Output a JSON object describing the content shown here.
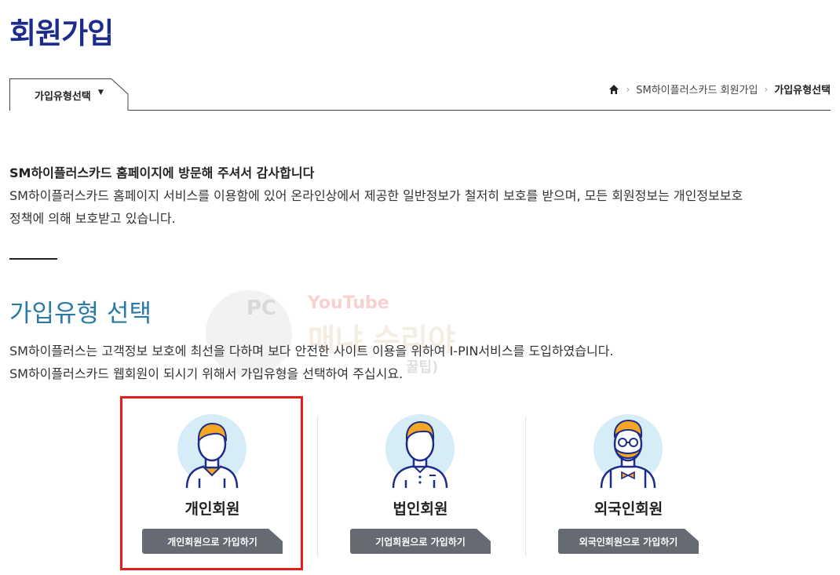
{
  "page": {
    "title": "회원가입"
  },
  "tab": {
    "label": "가입유형선택"
  },
  "breadcrumb": {
    "items": [
      "SM하이플러스카드 회원가입",
      "가입유형선택"
    ]
  },
  "intro": {
    "heading": "SM하이플러스카드 홈페이지에 방문해 주셔서 감사합니다",
    "line1": "SM하이플러스카드 홈페이지 서비스를 이용함에 있어 온라인상에서 제공한 일반정보가 철저히 보호를 받으며, 모든 회원정보는 개인정보보호",
    "line2": "정책에 의해 보호받고 있습니다."
  },
  "section": {
    "title": "가입유형 선택",
    "line1": "SM하이플러스는 고객정보 보호에 최선을 다하며 보다 안전한 사이트 이용을 위하여 I-PIN서비스를 도입하였습니다.",
    "line2": "SM하이플러스카드 웹회원이 되시기 위해서 가입유형을 선택하여 주십시요."
  },
  "watermark": {
    "pc": "PC",
    "youtube": "YouTube",
    "main": "매냐 수리야",
    "sub": "꿀팁)"
  },
  "cards": [
    {
      "name": "개인회원",
      "button": "개인회원으로 가입하기"
    },
    {
      "name": "법인회원",
      "button": "기업회원으로 가입하기"
    },
    {
      "name": "외국인회원",
      "button": "외국인회원으로 가입하기"
    }
  ],
  "colors": {
    "title": "#1c2c8c",
    "section_title": "#2a7aa8",
    "button": "#666a72",
    "highlight": "#e41e1e",
    "avatar_bg": "#d6ecf7",
    "hair": "#f5a623",
    "line": "#1c2c8c"
  }
}
